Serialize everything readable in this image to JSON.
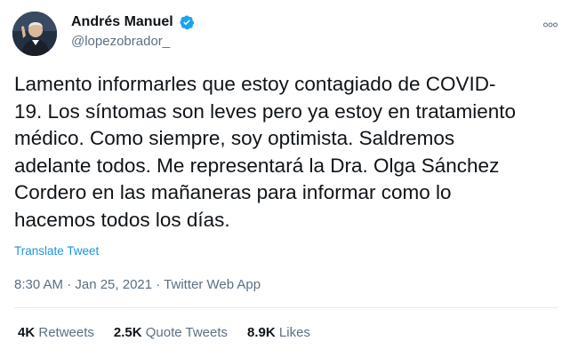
{
  "author": {
    "name": "Andrés Manuel",
    "handle": "@lopezobrador_",
    "verified_icon": "verified-badge-icon"
  },
  "more_icon": "more-options-icon",
  "tweet": {
    "text": "Lamento informarles que estoy contagiado de COVID-\n19. Los síntomas son leves pero ya estoy en tratamiento\nmédico. Como siempre, soy optimista. Saldremos\nadelante todos. Me representará la Dra. Olga Sánchez\nCordero en las mañaneras para informar como lo\nhacemos todos los días.",
    "translate_label": "Translate Tweet",
    "timestamp": "8:30 AM · Jan 25, 2021 · Twitter Web App"
  },
  "stats": {
    "retweets_count": "4K",
    "retweets_label": "Retweets",
    "quotes_count": "2.5K",
    "quotes_label": "Quote Tweets",
    "likes_count": "8.9K",
    "likes_label": "Likes"
  },
  "colors": {
    "link": "#1b95e0",
    "verified": "#1da1f2",
    "secondary_text": "#5b7083"
  }
}
